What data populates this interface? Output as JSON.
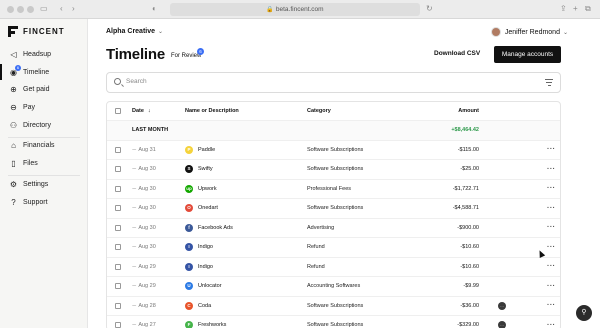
{
  "browser": {
    "url": "beta.fincent.com"
  },
  "sidebar": {
    "logo_text": "FINCENT",
    "items": [
      {
        "label": "Headsup",
        "icon": "megaphone-icon"
      },
      {
        "label": "Timeline",
        "icon": "timeline-icon",
        "badge": "6",
        "active": true
      },
      {
        "label": "Get paid",
        "icon": "dollar-icon"
      },
      {
        "label": "Pay",
        "icon": "pay-icon"
      },
      {
        "label": "Directory",
        "icon": "people-icon"
      },
      {
        "label": "Financials",
        "icon": "bank-icon"
      },
      {
        "label": "Files",
        "icon": "file-icon"
      },
      {
        "label": "Settings",
        "icon": "gear-icon"
      },
      {
        "label": "Support",
        "icon": "help-icon"
      }
    ]
  },
  "header": {
    "org": "Alpha Creative",
    "user": "Jeniffer Redmond",
    "title": "Timeline",
    "review_label": "For Review",
    "review_count": "6",
    "download_label": "Download CSV",
    "manage_label": "Manage accounts"
  },
  "search": {
    "placeholder": "Search"
  },
  "table": {
    "columns": {
      "date": "Date",
      "name": "Name or Description",
      "category": "Category",
      "amount": "Amount"
    },
    "group": {
      "label": "LAST MONTH",
      "total": "+$8,464.42"
    },
    "rows": [
      {
        "date": "Aug 31",
        "name": "Paddle",
        "category": "Software Subscriptions",
        "amount": "-$115.00",
        "logo_color": "#f5d33b",
        "logo_char": "P",
        "comment": false
      },
      {
        "date": "Aug 30",
        "name": "Swifty",
        "category": "Software Subscriptions",
        "amount": "-$25.00",
        "logo_color": "#111111",
        "logo_char": "S",
        "comment": false
      },
      {
        "date": "Aug 30",
        "name": "Upwork",
        "category": "Professional Fees",
        "amount": "-$1,722.71",
        "logo_color": "#14a800",
        "logo_char": "up",
        "comment": false
      },
      {
        "date": "Aug 30",
        "name": "Onedart",
        "category": "Software Subscriptions",
        "amount": "-$4,588.71",
        "logo_color": "#e34b3a",
        "logo_char": "O",
        "comment": false
      },
      {
        "date": "Aug 30",
        "name": "Facebook Ads",
        "category": "Advertising",
        "amount": "-$900.00",
        "logo_color": "#3b5998",
        "logo_char": "f",
        "comment": false
      },
      {
        "date": "Aug 30",
        "name": "Indigo",
        "category": "Refund",
        "amount": "-$10.60",
        "logo_color": "#3554a5",
        "logo_char": "I",
        "comment": false
      },
      {
        "date": "Aug 29",
        "name": "Indigo",
        "category": "Refund",
        "amount": "-$10.60",
        "logo_color": "#3554a5",
        "logo_char": "I",
        "comment": false
      },
      {
        "date": "Aug 29",
        "name": "Unlocator",
        "category": "Accounting Softwares",
        "amount": "-$9.99",
        "logo_color": "#2c7be5",
        "logo_char": "U",
        "comment": false
      },
      {
        "date": "Aug 28",
        "name": "Coda",
        "category": "Software Subscriptions",
        "amount": "-$36.00",
        "logo_color": "#e8542a",
        "logo_char": "C",
        "comment": true
      },
      {
        "date": "Aug 27",
        "name": "Freshworks",
        "category": "Software Subscriptions",
        "amount": "-$329.00",
        "logo_color": "#45b44a",
        "logo_char": "F",
        "comment": true
      }
    ]
  },
  "colors": {
    "accent": "#3b6ef5",
    "positive": "#2e9a4c",
    "primary_button": "#111111"
  }
}
